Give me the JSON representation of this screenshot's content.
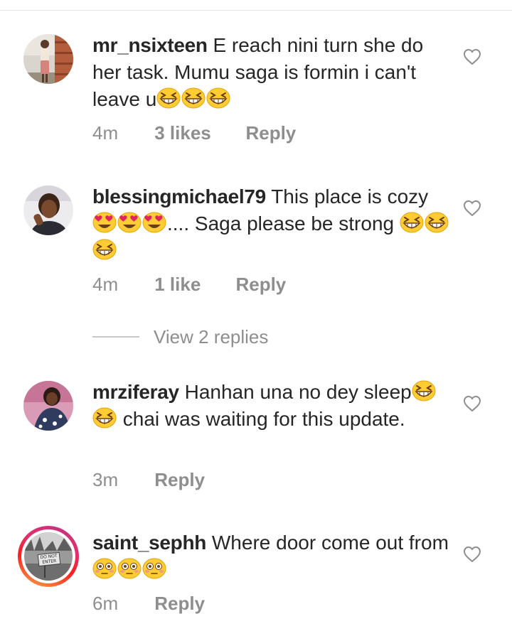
{
  "comments": [
    {
      "username": "mr_nsixteen",
      "parts": [
        "E reach nini turn she do her task. Mumu saga is formin i can't leave u",
        "",
        "",
        ""
      ],
      "time": "4m",
      "likes": "3 likes",
      "reply": "Reply"
    },
    {
      "username": "blessingmichael79",
      "parts": [
        "This place is cozy ",
        "",
        "",
        "",
        ".... Saga please be strong ",
        "",
        "",
        ""
      ],
      "time": "4m",
      "likes": "1 like",
      "reply": "Reply"
    },
    {
      "username": "mrziferay",
      "parts": [
        "Hanhan una no dey sleep",
        "",
        "",
        " chai was waiting for this update."
      ],
      "time": "3m",
      "reply": "Reply"
    },
    {
      "username": "saint_sephh",
      "parts": [
        "Where door come out from ",
        "",
        "",
        ""
      ],
      "time": "6m",
      "reply": "Reply"
    }
  ],
  "view_replies": "View 2 replies",
  "avatar_sign_text": "DO NOT ENTER",
  "emoji_names": {
    "grin": "grinning-squinting-face",
    "heart_eyes": "smiling-face-with-heart-eyes",
    "flushed": "flushed-face"
  },
  "colors": {
    "text": "#262626",
    "muted": "#8e8e8e",
    "emoji_yellow": "#ffcc33",
    "heart_red": "#e0245e"
  }
}
